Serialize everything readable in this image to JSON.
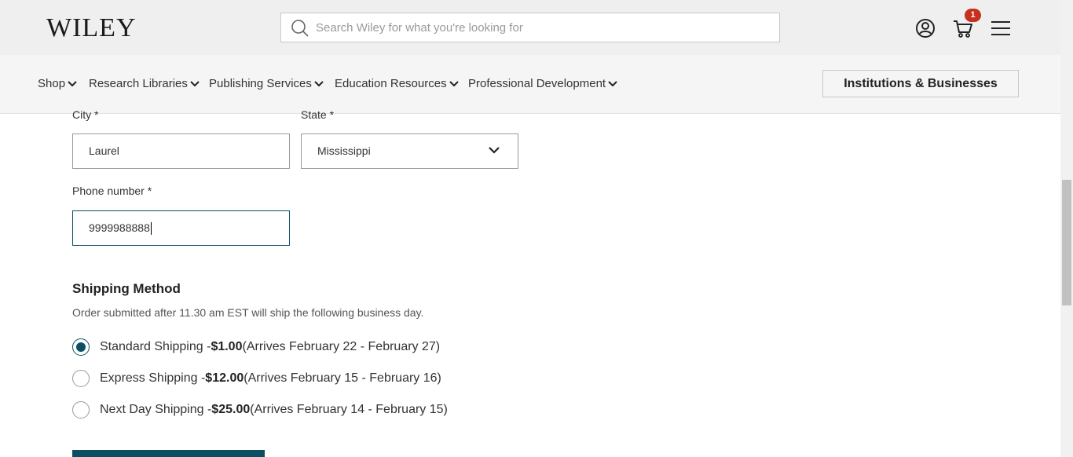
{
  "header": {
    "logo": "WILEY",
    "search_placeholder": "Search Wiley for what you're looking for",
    "cart_count": "1",
    "icons": [
      "search-icon",
      "user-icon",
      "cart-icon",
      "menu-icon"
    ]
  },
  "nav": {
    "items": [
      {
        "label": "Shop"
      },
      {
        "label": "Research Libraries"
      },
      {
        "label": "Publishing Services"
      },
      {
        "label": "Education Resources"
      },
      {
        "label": "Professional Development"
      }
    ],
    "institutions_button": "Institutions & Businesses"
  },
  "form": {
    "city_label": "City *",
    "city_value": "Laurel",
    "state_label": "State *",
    "state_value": "Mississippi",
    "phone_label": "Phone number *",
    "phone_value": "9999988888"
  },
  "shipping": {
    "title": "Shipping Method",
    "note": "Order submitted after 11.30 am EST will ship the following business day.",
    "options": [
      {
        "name": "Standard Shipping - ",
        "price": "$1.00",
        "arrival": " (Arrives February 22 - February 27)",
        "selected": true
      },
      {
        "name": "Express Shipping - ",
        "price": "$12.00",
        "arrival": " (Arrives February 15 - February 16)",
        "selected": false
      },
      {
        "name": "Next Day Shipping - ",
        "price": "$25.00",
        "arrival": " (Arrives February 14 - February 15)",
        "selected": false
      }
    ]
  },
  "colors": {
    "accent": "#0b4f63",
    "badge": "#c8301e",
    "header_bg": "#efefef"
  }
}
